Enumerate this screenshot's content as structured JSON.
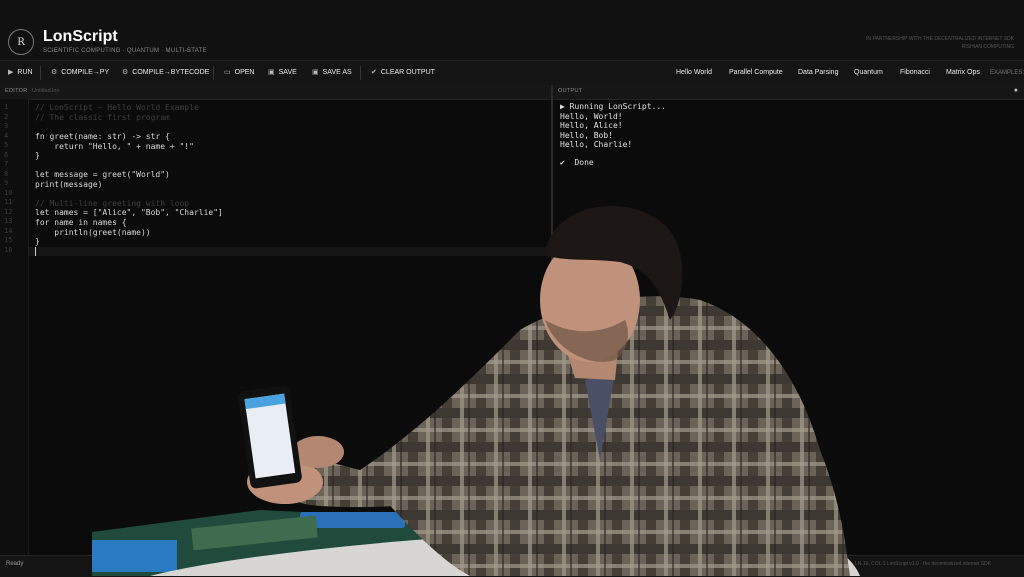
{
  "header": {
    "logo_letter": "R",
    "title": "LonScript",
    "tagline": "SCIENTIFIC COMPUTING · QUANTUM · MULTI-STATE",
    "partner_line1": "IN PARTNERSHIP WITH THE DECENTRALIZED INTERNET SDK",
    "partner_line2": "RISHIAN COMPUTING"
  },
  "toolbar": {
    "run": "RUN",
    "compile_py": "COMPILE→PY",
    "compile_bytecode": "COMPILE→BYTECODE",
    "open": "OPEN",
    "save": "SAVE",
    "save_as": "SAVE AS",
    "clear_output": "CLEAR OUTPUT",
    "examples_label": "EXAMPLES:",
    "examples": [
      "Hello World",
      "Parallel Compute",
      "Data Parsing",
      "Quantum",
      "Fibonacci",
      "Matrix Ops"
    ]
  },
  "editor": {
    "title": "EDITOR",
    "file_name": "Untitled.lon",
    "line_numbers": [
      "1",
      "2",
      "3",
      "4",
      "5",
      "6",
      "7",
      "8",
      "9",
      "10",
      "11",
      "12",
      "13",
      "14",
      "15",
      "16"
    ],
    "lines": [
      "// LonScript — Hello World Example",
      "// The classic first program",
      "",
      "fn greet(name: str) -> str {",
      "    return \"Hello, \" + name + \"!\"",
      "}",
      "",
      "let message = greet(\"World\")",
      "print(message)",
      "",
      "// Multi-line greeting with loop",
      "let names = [\"Alice\", \"Bob\", \"Charlie\"]",
      "for name in names {",
      "    println(greet(name))",
      "}",
      ""
    ]
  },
  "output": {
    "title": "OUTPUT",
    "close_glyph": "●",
    "lines": [
      "▶ Running LonScript...",
      "Hello, World!",
      "Hello, Alice!",
      "Hello, Bob!",
      "Hello, Charlie!",
      "",
      "✔  Done"
    ]
  },
  "status": {
    "text": "Ready",
    "right": "LN 16, COL 1    LonScript v1.0 · the decentralized internet SDK"
  },
  "colors": {
    "background": "#0d0d0d",
    "comment": "#3d3d3d",
    "text": "#d8d8d8"
  }
}
